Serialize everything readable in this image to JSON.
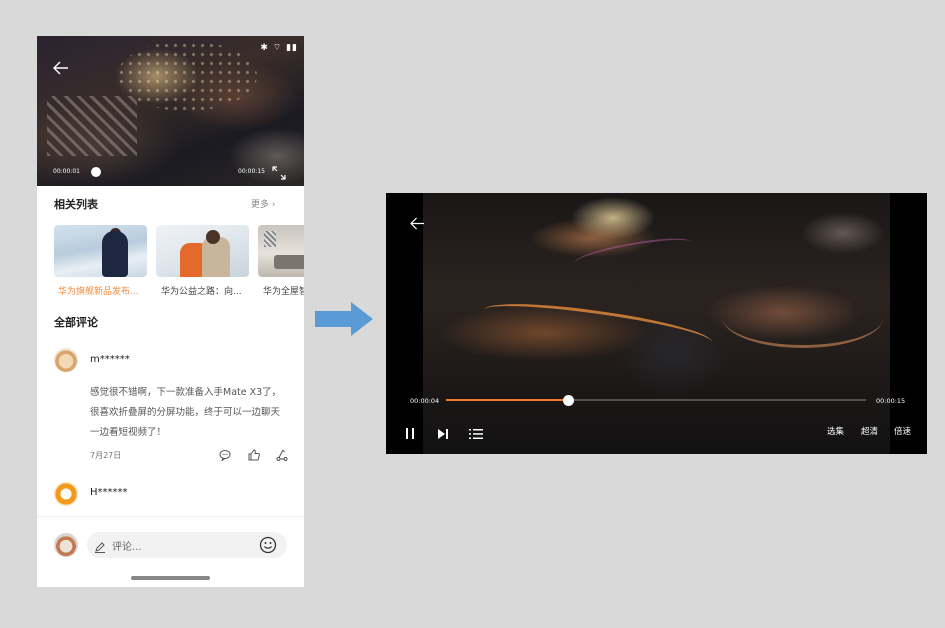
{
  "phone": {
    "status_icons": "✱ ⌔ ▮▮",
    "video": {
      "current_time": "00:00:01",
      "total_time": "00:00:15",
      "progress": 0.03
    },
    "related": {
      "title": "相关列表",
      "more_label": "更多",
      "items": [
        {
          "caption": "华为旗舰新品发布..."
        },
        {
          "caption": "华为公益之路：向..."
        },
        {
          "caption": "华为全屋智"
        }
      ]
    },
    "comments_title": "全部评论",
    "comments": [
      {
        "user": "m******",
        "lines": [
          "感觉很不错啊，下一款准备入手Mate X3了，",
          "很喜欢折叠屏的分屏功能，终于可以一边聊天",
          "一边看短视频了！"
        ],
        "date": "7月27日"
      },
      {
        "user": "H******"
      }
    ],
    "comment_input_placeholder": "评论..."
  },
  "player": {
    "current_time": "00:00:04",
    "total_time": "00:00:15",
    "progress": 0.29,
    "episodes_label": "选集",
    "quality_label": "超清",
    "speed_label": "倍速"
  },
  "colors": {
    "accent": "#f07a2c",
    "arrow": "#5b9bd5"
  }
}
